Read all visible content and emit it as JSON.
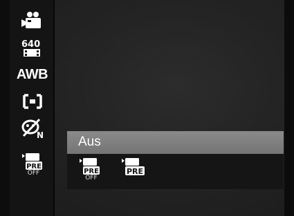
{
  "sidebar": {
    "items": [
      {
        "icon": "movie-camera-icon"
      },
      {
        "icon": "resolution-640-icon",
        "label": "640"
      },
      {
        "icon": "white-balance-icon",
        "label": "AWB"
      },
      {
        "icon": "focus-area-icon"
      },
      {
        "icon": "face-detect-off-icon",
        "sub": "N"
      },
      {
        "icon": "pre-record-icon",
        "badge": "PRE",
        "caption": "OFF"
      }
    ]
  },
  "menu": {
    "title": "Aus",
    "options": [
      {
        "icon": "pre-record-off-icon",
        "badge": "PRE",
        "caption": "OFF"
      },
      {
        "icon": "pre-record-on-icon",
        "badge": "PRE"
      }
    ]
  },
  "colors": {
    "menu_header": "#7f7f7f",
    "sidebar": "#141414",
    "background": "#242424"
  }
}
